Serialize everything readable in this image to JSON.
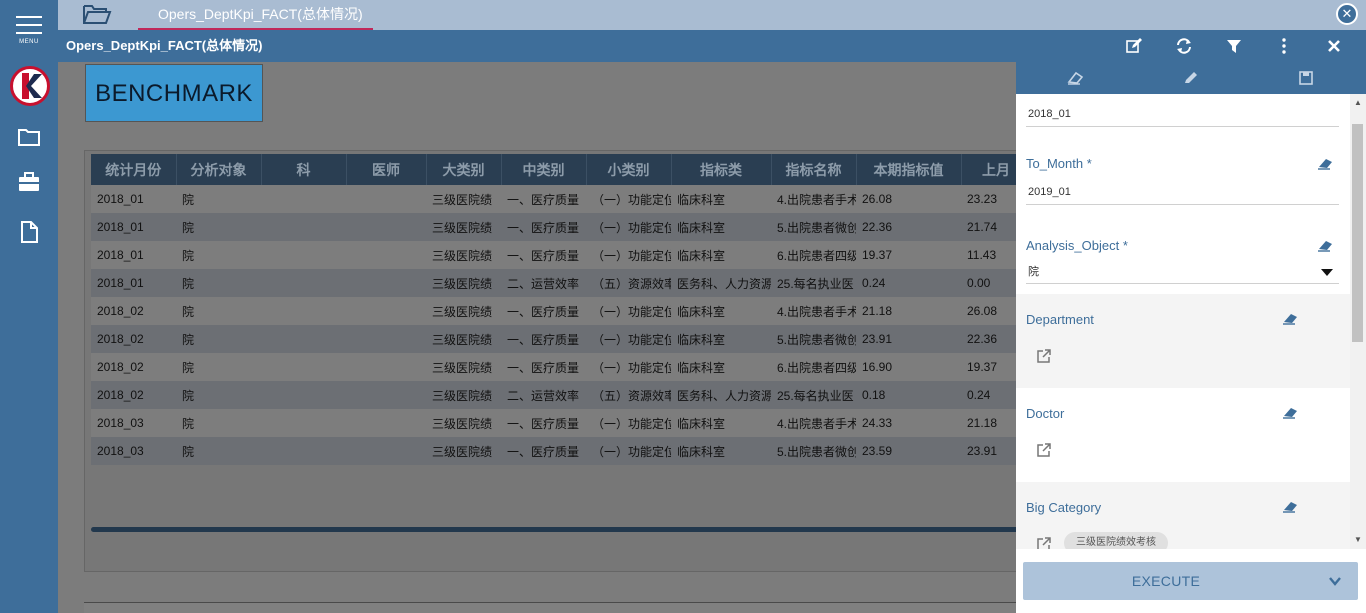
{
  "sidebar": {
    "menu_label": "MENU",
    "logo_letter": "K",
    "items": [
      {
        "icon": "folder-icon"
      },
      {
        "icon": "briefcase-icon"
      },
      {
        "icon": "document-icon"
      }
    ]
  },
  "tabs": {
    "active_label": "Opers_DeptKpi_FACT(总体情况)"
  },
  "header": {
    "title": "Opers_DeptKpi_FACT(总体情况)",
    "toolbar_icons": [
      "edit-icon",
      "refresh-icon",
      "filter-icon",
      "more-vertical-icon",
      "close-icon"
    ]
  },
  "report": {
    "banner_text": "BENCHMARK",
    "columns": [
      "统计月份",
      "分析对象",
      "科",
      "医师",
      "大类别",
      "中类别",
      "小类别",
      "指标类",
      "指标名称",
      "本期指标值",
      "上月"
    ],
    "rows": [
      [
        "2018_01",
        "院",
        "",
        "",
        "三级医院绩",
        "一、医疗质量",
        "（一）功能定位",
        "临床科室",
        "4.出院患者手术",
        "26.08",
        "23.23"
      ],
      [
        "2018_01",
        "院",
        "",
        "",
        "三级医院绩",
        "一、医疗质量",
        "（一）功能定位",
        "临床科室",
        "5.出院患者微创",
        "22.36",
        "21.74"
      ],
      [
        "2018_01",
        "院",
        "",
        "",
        "三级医院绩",
        "一、医疗质量",
        "（一）功能定位",
        "临床科室",
        "6.出院患者四级",
        "19.37",
        "11.43"
      ],
      [
        "2018_01",
        "院",
        "",
        "",
        "三级医院绩",
        "二、运营效率",
        "（五）资源效率",
        "医务科、人力资源",
        "25.每名执业医",
        "0.24",
        "0.00"
      ],
      [
        "2018_02",
        "院",
        "",
        "",
        "三级医院绩",
        "一、医疗质量",
        "（一）功能定位",
        "临床科室",
        "4.出院患者手术",
        "21.18",
        "26.08"
      ],
      [
        "2018_02",
        "院",
        "",
        "",
        "三级医院绩",
        "一、医疗质量",
        "（一）功能定位",
        "临床科室",
        "5.出院患者微创",
        "23.91",
        "22.36"
      ],
      [
        "2018_02",
        "院",
        "",
        "",
        "三级医院绩",
        "一、医疗质量",
        "（一）功能定位",
        "临床科室",
        "6.出院患者四级",
        "16.90",
        "19.37"
      ],
      [
        "2018_02",
        "院",
        "",
        "",
        "三级医院绩",
        "二、运营效率",
        "（五）资源效率",
        "医务科、人力资源",
        "25.每名执业医",
        "0.18",
        "0.24"
      ],
      [
        "2018_03",
        "院",
        "",
        "",
        "三级医院绩",
        "一、医疗质量",
        "（一）功能定位",
        "临床科室",
        "4.出院患者手术",
        "24.33",
        "21.18"
      ],
      [
        "2018_03",
        "院",
        "",
        "",
        "三级医院绩",
        "一、医疗质量",
        "（一）功能定位",
        "临床科室",
        "5.出院患者微创",
        "23.59",
        "23.91"
      ]
    ]
  },
  "panel": {
    "tool_icons": [
      "eraser-icon",
      "pencil-icon",
      "save-icon"
    ],
    "from_month_value": "2018_01",
    "to_month": {
      "label": "To_Month *",
      "value": "2019_01"
    },
    "analysis_object": {
      "label": "Analysis_Object *",
      "value": "院"
    },
    "department": {
      "label": "Department"
    },
    "doctor": {
      "label": "Doctor"
    },
    "big_category": {
      "label": "Big Category",
      "chip": "三级医院绩效考核"
    },
    "execute_label": "EXECUTE"
  },
  "colors": {
    "primary": "#3e6e9a",
    "tab_bar": "#a9bcd2",
    "active_tab_underline": "#c0285a",
    "execute_bg": "#adc3da",
    "logo_red": "#c8102e"
  }
}
